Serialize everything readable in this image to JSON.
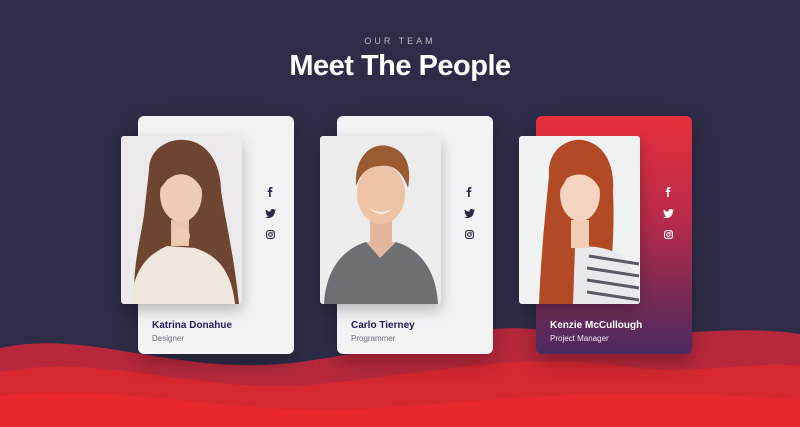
{
  "header": {
    "eyebrow": "OUR TEAM",
    "title": "Meet The People"
  },
  "colors": {
    "background": "#2e2c48",
    "accent": "#e8303a",
    "name_text": "#1f1d5c"
  },
  "team": [
    {
      "name": "Katrina Donahue",
      "role": "Designer",
      "highlight": false
    },
    {
      "name": "Carlo Tierney",
      "role": "Programmer",
      "highlight": false
    },
    {
      "name": "Kenzie McCullough",
      "role": "Project Manager",
      "highlight": true
    }
  ],
  "social_icons": [
    "facebook-icon",
    "twitter-icon",
    "instagram-icon"
  ]
}
